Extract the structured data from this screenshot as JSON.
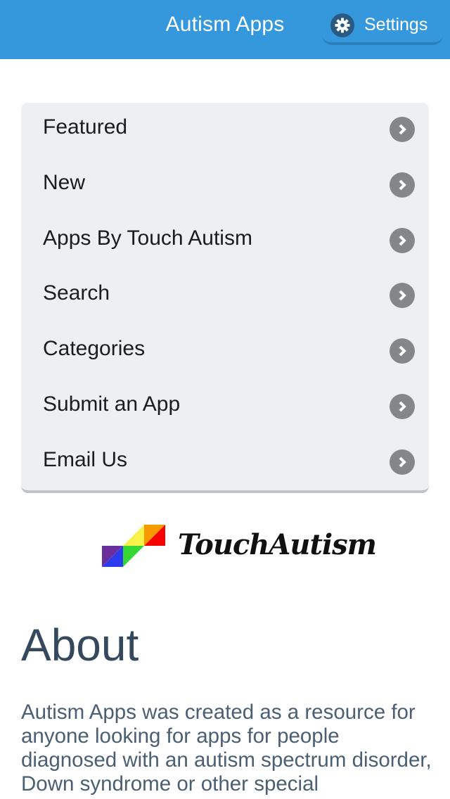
{
  "header": {
    "title": "Autism Apps",
    "settings_label": "Settings",
    "settings_icon": "gear-icon",
    "background_color": "#3598dc"
  },
  "menu": {
    "items": [
      {
        "label": "Featured",
        "icon": "chevron-right-icon"
      },
      {
        "label": "New",
        "icon": "chevron-right-icon"
      },
      {
        "label": "Apps By Touch Autism",
        "icon": "chevron-right-icon"
      },
      {
        "label": "Search",
        "icon": "chevron-right-icon"
      },
      {
        "label": "Categories",
        "icon": "chevron-right-icon"
      },
      {
        "label": "Submit an App",
        "icon": "chevron-right-icon"
      },
      {
        "label": "Email Us",
        "icon": "chevron-right-icon"
      }
    ]
  },
  "logo": {
    "text": "TouchAutism",
    "colors": [
      "#6a2f9c",
      "#2b3cf0",
      "#33d633",
      "#f7f34a",
      "#f79a00",
      "#f60000"
    ]
  },
  "about": {
    "title": "About",
    "text": "Autism Apps was created as a resource for anyone looking for apps for people diagnosed with an autism spectrum disorder, Down syndrome or other special"
  }
}
